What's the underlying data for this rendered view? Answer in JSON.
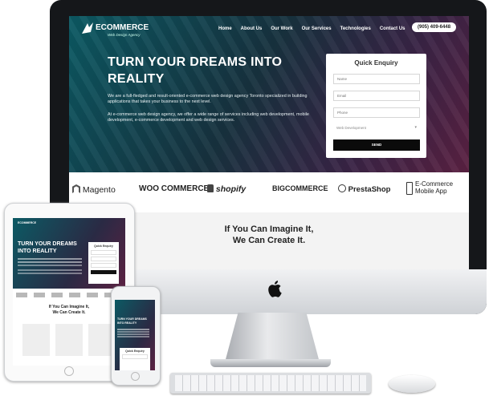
{
  "site": {
    "logo_main": "ECOMMERCE",
    "logo_sub": "Web Design Agency",
    "nav": [
      "Home",
      "About Us",
      "Our Work",
      "Our Services",
      "Technologies",
      "Contact Us"
    ],
    "phone": "(905) 409-6448",
    "hero_title_1": "TURN YOUR DREAMS INTO",
    "hero_title_2": "REALITY",
    "hero_p1": "We are a full-fledged and result-oriented e-commerce web design agency Toronto specialized in building applications that takes your business to the next level.",
    "hero_p2": "At e-commerce web design agency, we offer a wide range of services including web development, mobile development, e-commerce development and web design services.",
    "form": {
      "title": "Quick Enquiry",
      "name_placeholder": "Name",
      "email_placeholder": "Email",
      "phone_placeholder": "Phone",
      "select_value": "Web Development",
      "send_label": "SEND"
    },
    "logos": [
      "Magento",
      "WOO COMMERCE",
      "shopify",
      "BIGCOMMERCE",
      "PrestaShop",
      "E-Commerce",
      "Mobile App"
    ],
    "tagline_1": "If You Can Imagine It,",
    "tagline_2": "We Can Create It."
  },
  "tablet": {
    "hero_title_1": "TURN YOUR DREAMS",
    "hero_title_2": "INTO REALITY",
    "form_title": "Quick Enquiry",
    "tagline_1": "If You Can Imagine It,",
    "tagline_2": "We Can Create It."
  },
  "phone_device": {
    "hero_title": "TURN YOUR DREAMS INTO REALITY",
    "form_title": "Quick Enquiry"
  },
  "colors": {
    "hero_teal": "#0c5a64",
    "hero_magenta": "#5b2142",
    "send_button": "#0b0b0b"
  }
}
